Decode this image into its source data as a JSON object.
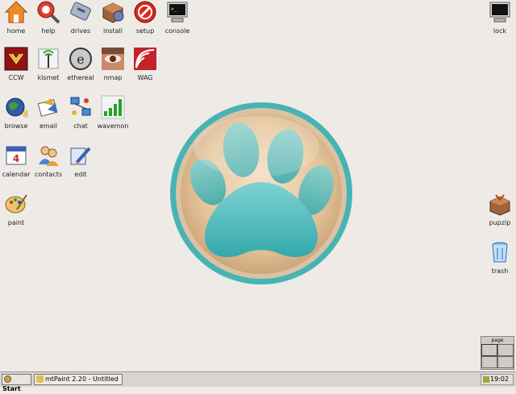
{
  "desktop_icons": {
    "home": {
      "label": "home"
    },
    "help": {
      "label": "help"
    },
    "drives": {
      "label": "drives"
    },
    "install": {
      "label": "install"
    },
    "setup": {
      "label": "setup"
    },
    "console": {
      "label": "console"
    },
    "lock": {
      "label": "lock"
    },
    "ccw": {
      "label": "CCW"
    },
    "kismet": {
      "label": "kismet"
    },
    "ethereal": {
      "label": "ethereal"
    },
    "nmap": {
      "label": "nmap"
    },
    "wag": {
      "label": "WAG"
    },
    "browse": {
      "label": "browse"
    },
    "email": {
      "label": "email"
    },
    "chat": {
      "label": "chat"
    },
    "wavemon": {
      "label": "wavemon"
    },
    "calendar": {
      "label": "calendar"
    },
    "contacts": {
      "label": "contacts"
    },
    "edit": {
      "label": "edit"
    },
    "paint": {
      "label": "paint"
    },
    "pupzip": {
      "label": "pupzip"
    },
    "trash": {
      "label": "trash"
    }
  },
  "taskbar": {
    "start_label": "Start",
    "window_task_label": "mtPaint 2.20 - Untitled",
    "clock": "19:02"
  },
  "pager": {
    "label": "page"
  },
  "colors": {
    "desktop_bg": "#eeebe7",
    "logo_teal": "#3fb4b6",
    "logo_tan": "#e7c89e",
    "taskbar_bg": "#d8d4cf"
  }
}
